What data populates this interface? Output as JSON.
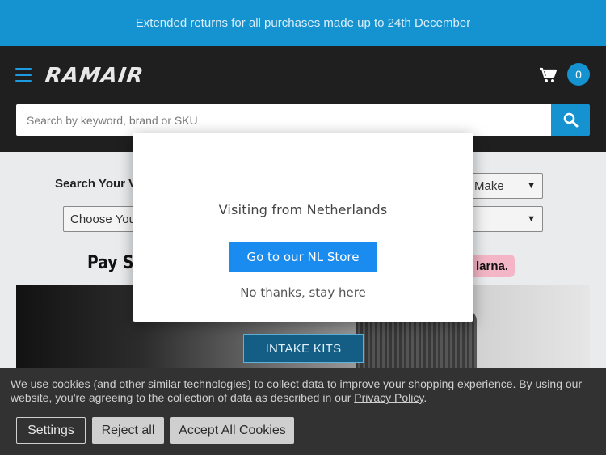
{
  "promo": {
    "text": "Extended returns for all purchases made up to 24th December"
  },
  "header": {
    "logo_text": "RAMAIR",
    "cart_count": "0",
    "search": {
      "placeholder": "Search by keyword, brand or SKU",
      "value": ""
    }
  },
  "vehicle_search": {
    "label": "Search Your V",
    "make_select": "Make",
    "choose_select": "Choose You",
    "model_select": ""
  },
  "payment": {
    "text": "Pay Sm",
    "klarna_label": "larna."
  },
  "hero": {
    "cta_label": "INTAKE KITS"
  },
  "modal": {
    "title": "Visiting from Netherlands",
    "go_button": "Go to our NL Store",
    "stay_link": "No thanks, stay here"
  },
  "cookie": {
    "text_before_link": "We use cookies (and other similar technologies) to collect data to improve your shopping experience. By using our website, you're agreeing to the collection of data as described in our ",
    "link_text": "Privacy Policy",
    "text_after_link": ".",
    "settings_label": "Settings",
    "reject_label": "Reject all",
    "accept_label": "Accept All Cookies"
  },
  "colors": {
    "brand_blue": "#1592d0",
    "header_bg": "#1f1f1f",
    "modal_button": "#1a8cf0",
    "klarna_pink": "#f4b6c6"
  }
}
